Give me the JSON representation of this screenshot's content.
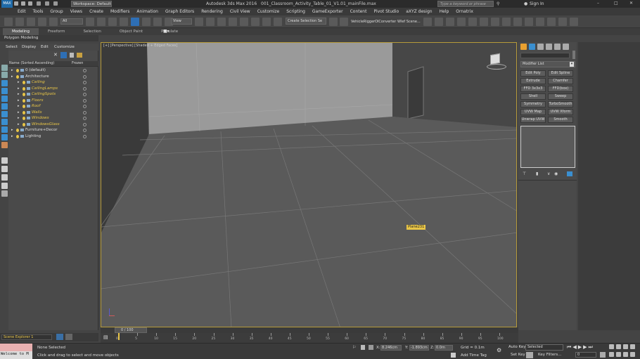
{
  "titlebar": {
    "workspace": "Workspace: Default",
    "title": "Autodesk 3ds Max 2016",
    "file": "001_Classroom_Activity_Table_01_V1.01_mainFile.max",
    "search_placeholder": "Type a keyword or phrase",
    "signin": "Sign In"
  },
  "menu": [
    "Edit",
    "Tools",
    "Group",
    "Views",
    "Create",
    "Modifiers",
    "Animation",
    "Graph Editors",
    "Rendering",
    "Civil View",
    "Customize",
    "Scripting",
    "GameExporter",
    "Content",
    "Pivot Studio",
    "aXYZ design",
    "Help",
    "Ornatrix"
  ],
  "toolbar": {
    "selection_filter": "All",
    "view_dropdown": "View",
    "named_selection": "Create Selection Se",
    "vehicle_rigger": "VehicleRigger",
    "oi_converter": "OIConverter",
    "wlef_scene": "Wlef Scene..."
  },
  "ribbon": {
    "tabs": [
      "Modeling",
      "Freeform",
      "Selection",
      "Object Paint",
      "Populate"
    ],
    "sub": "Polygon Modeling"
  },
  "scene_explorer": {
    "menu": [
      "Select",
      "Display",
      "Edit",
      "Customize"
    ],
    "col_name": "Name (Sorted Ascending)",
    "col_frozen": "Frozen",
    "rows": [
      {
        "label": "0 (default)",
        "indent": 0,
        "italic": false
      },
      {
        "label": "Architecture",
        "indent": 0,
        "italic": false
      },
      {
        "label": "Ceiling",
        "indent": 1,
        "italic": true
      },
      {
        "label": "CeilingLamps",
        "indent": 1,
        "italic": true
      },
      {
        "label": "CeilingSpots",
        "indent": 1,
        "italic": true
      },
      {
        "label": "Floors",
        "indent": 1,
        "italic": true
      },
      {
        "label": "Roof",
        "indent": 1,
        "italic": true
      },
      {
        "label": "Walls",
        "indent": 1,
        "italic": true
      },
      {
        "label": "Windows",
        "indent": 1,
        "italic": true
      },
      {
        "label": "WindowsGlass",
        "indent": 1,
        "italic": true
      },
      {
        "label": "Furniture+Decor",
        "indent": 0,
        "italic": false
      },
      {
        "label": "Lighting",
        "indent": 0,
        "italic": false
      }
    ],
    "footer": "Scene Explorer 1"
  },
  "viewport": {
    "label": "[+] [Perspective] [Shaded + Edged Faces]",
    "tooltip": "Plane231"
  },
  "command_panel": {
    "modifier_list": "Modifier List",
    "buttons": [
      [
        "Edit Poly",
        "Edit Spline"
      ],
      [
        "Extrude",
        "Chamfer"
      ],
      [
        "FFD 3x3x3",
        "FFD(box)"
      ],
      [
        "Shell",
        "Sweep"
      ],
      [
        "Symmetry",
        "TurboSmooth"
      ],
      [
        "UVW Map",
        "UVW Xform"
      ],
      [
        "Unwrap UVW",
        "Smooth"
      ]
    ]
  },
  "timeline": {
    "frame": "0 / 100",
    "ticks": [
      "0",
      "5",
      "10",
      "15",
      "20",
      "25",
      "30",
      "35",
      "40",
      "45",
      "50",
      "55",
      "60",
      "65",
      "70",
      "75",
      "80",
      "85",
      "90",
      "95",
      "100"
    ]
  },
  "status": {
    "maxscript": "Welcome to M",
    "selected": "None Selected",
    "prompt": "Click and drag to select and move objects",
    "x_label": "X:",
    "x_value": "8.246cm",
    "y_label": "Y:",
    "y_value": "-1.893cm",
    "z_label": "Z:",
    "z_value": "0.0m",
    "grid": "Grid = 0.1m",
    "add_time_tag": "Add Time Tag",
    "auto_key": "Auto Key",
    "set_key": "Set Key",
    "key_dropdown": "Selected",
    "key_filters": "Key Filters...",
    "frame_field": "0"
  },
  "colors": {
    "viewport_border": "#b59a3a",
    "tooltip_bg": "#e8c547",
    "active_blue": "#2e6fb5",
    "autokey_red": "#e06060"
  }
}
